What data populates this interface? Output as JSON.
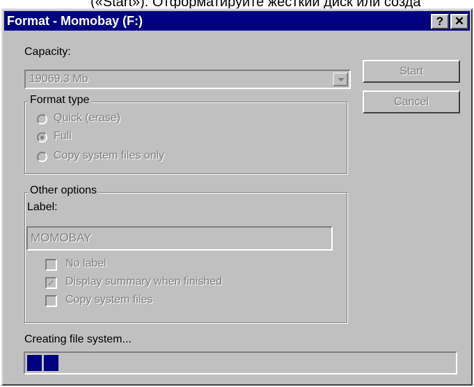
{
  "background_text": "(«Start»). Отформатируйте жесткий диск или созда",
  "window": {
    "title": "Format - Momobay (F:)",
    "help_button": "?",
    "close_button": "✕"
  },
  "capacity": {
    "label": "Capacity:",
    "value": "19069.3 Mb"
  },
  "buttons": {
    "start": "Start",
    "cancel": "Cancel"
  },
  "format_type": {
    "title": "Format type",
    "options": [
      {
        "label": "Quick (erase)",
        "selected": false
      },
      {
        "label": "Full",
        "selected": true
      },
      {
        "label": "Copy system files only",
        "selected": false
      }
    ]
  },
  "other_options": {
    "title": "Other options",
    "label_field": {
      "label": "Label:",
      "value": "MOMOBAY"
    },
    "checkboxes": [
      {
        "label": "No label",
        "checked": false
      },
      {
        "label": "Display summary when finished",
        "checked": true
      },
      {
        "label": "Copy system files",
        "checked": false
      }
    ]
  },
  "status": {
    "text": "Creating file system...",
    "progress_blocks": 2
  },
  "colors": {
    "titlebar": "#000080",
    "face": "#c0c0c0",
    "progress": "#000080"
  }
}
